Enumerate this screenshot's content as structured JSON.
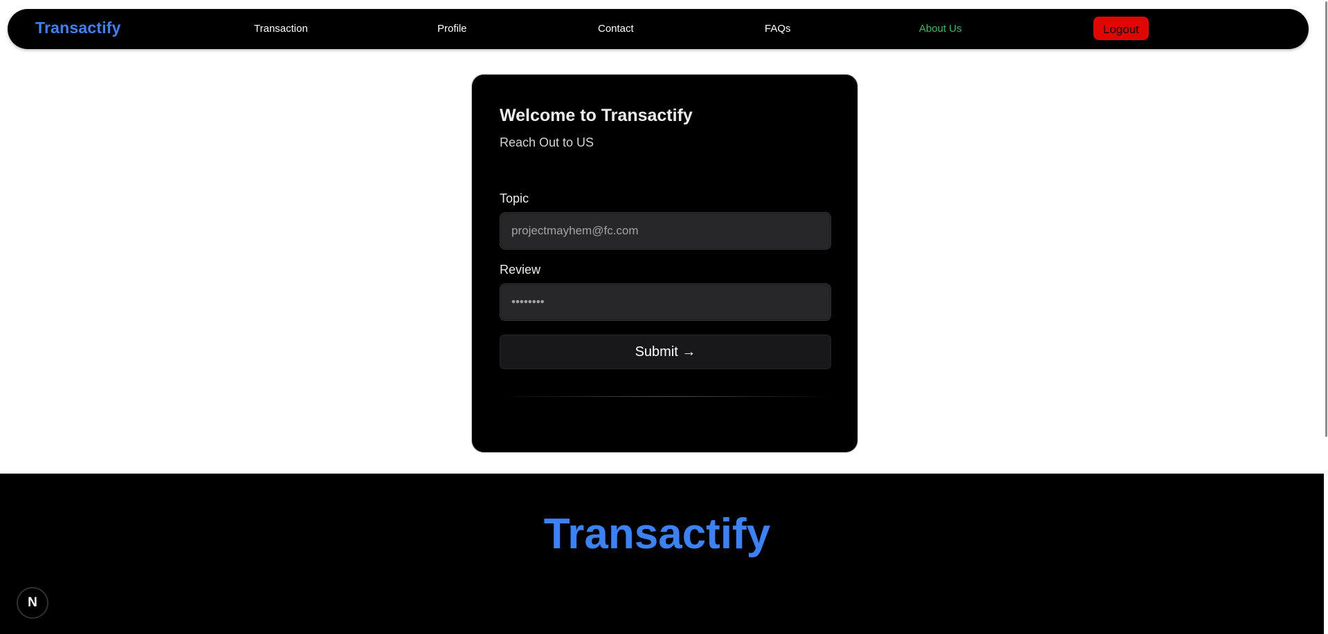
{
  "navbar": {
    "brand": "Transactify",
    "links": [
      {
        "label": "Transaction"
      },
      {
        "label": "Profile"
      },
      {
        "label": "Contact"
      },
      {
        "label": "FAQs"
      },
      {
        "label": "About Us",
        "active": true
      }
    ],
    "logout_label": "Logout",
    "active_color": "#22c55e",
    "logout_color": "#e10600"
  },
  "card": {
    "title": "Welcome to Transactify",
    "subtitle": "Reach Out to US",
    "topic_label": "Topic",
    "topic_placeholder": "projectmayhem@fc.com",
    "review_label": "Review",
    "review_value": "••••••••",
    "submit_label": "Submit →"
  },
  "footer": {
    "brand": "Transactify"
  },
  "next_badge": {
    "letter": "N"
  },
  "colors": {
    "brand_blue": "#3b82f6",
    "background": "#ffffff",
    "dark": "#000000"
  }
}
